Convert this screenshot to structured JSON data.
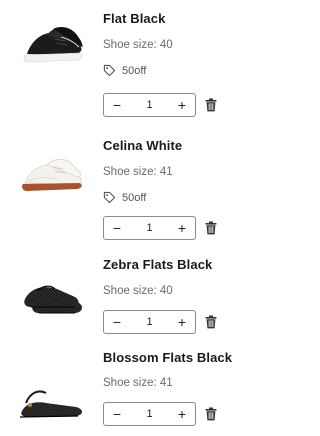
{
  "cart": {
    "items": [
      {
        "name": "Flat Black",
        "size": "Shoe size: 40",
        "discount": "50off",
        "quantity": "1",
        "image_icon": "black-sneaker-icon"
      },
      {
        "name": "Celina White",
        "size": "Shoe size: 41",
        "discount": "50off",
        "quantity": "1",
        "image_icon": "white-sneaker-icon"
      },
      {
        "name": "Zebra Flats Black",
        "size": "Shoe size: 40",
        "quantity": "1",
        "image_icon": "black-mesh-flat-icon"
      },
      {
        "name": "Blossom Flats Black",
        "size": "Shoe size: 41",
        "quantity": "1",
        "image_icon": "black-strap-flat-icon"
      }
    ],
    "controls": {
      "decrease_symbol": "−",
      "increase_symbol": "+"
    }
  }
}
